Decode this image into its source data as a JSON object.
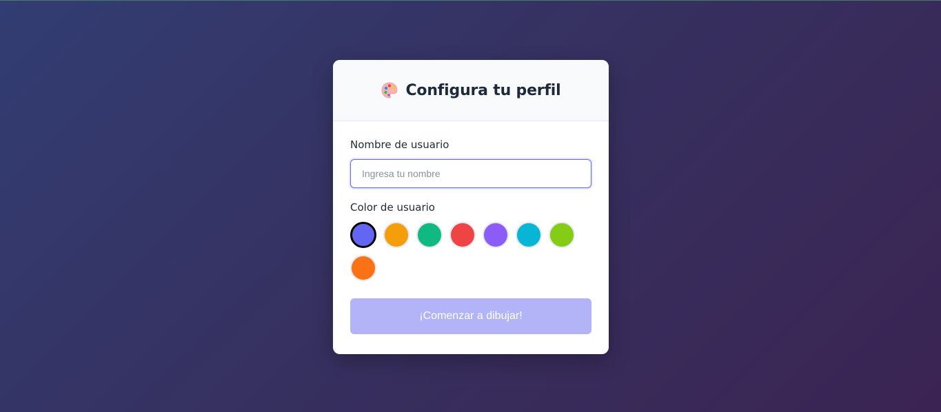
{
  "profile_card": {
    "title": "Configura tu perfil",
    "title_icon": "palette-icon",
    "username": {
      "label": "Nombre de usuario",
      "value": "",
      "placeholder": "Ingresa tu nombre"
    },
    "color": {
      "label": "Color de usuario",
      "selected": "#6366f1",
      "options": [
        "#6366f1",
        "#f59e0b",
        "#10b981",
        "#ef4444",
        "#8b5cf6",
        "#06b6d4",
        "#84cc16",
        "#f97316"
      ]
    },
    "start_button": {
      "label": "¡Comenzar a dibujar!",
      "disabled": true
    }
  },
  "colors": {
    "accent": "#6366f1",
    "button_disabled": "#b3b3f8"
  }
}
